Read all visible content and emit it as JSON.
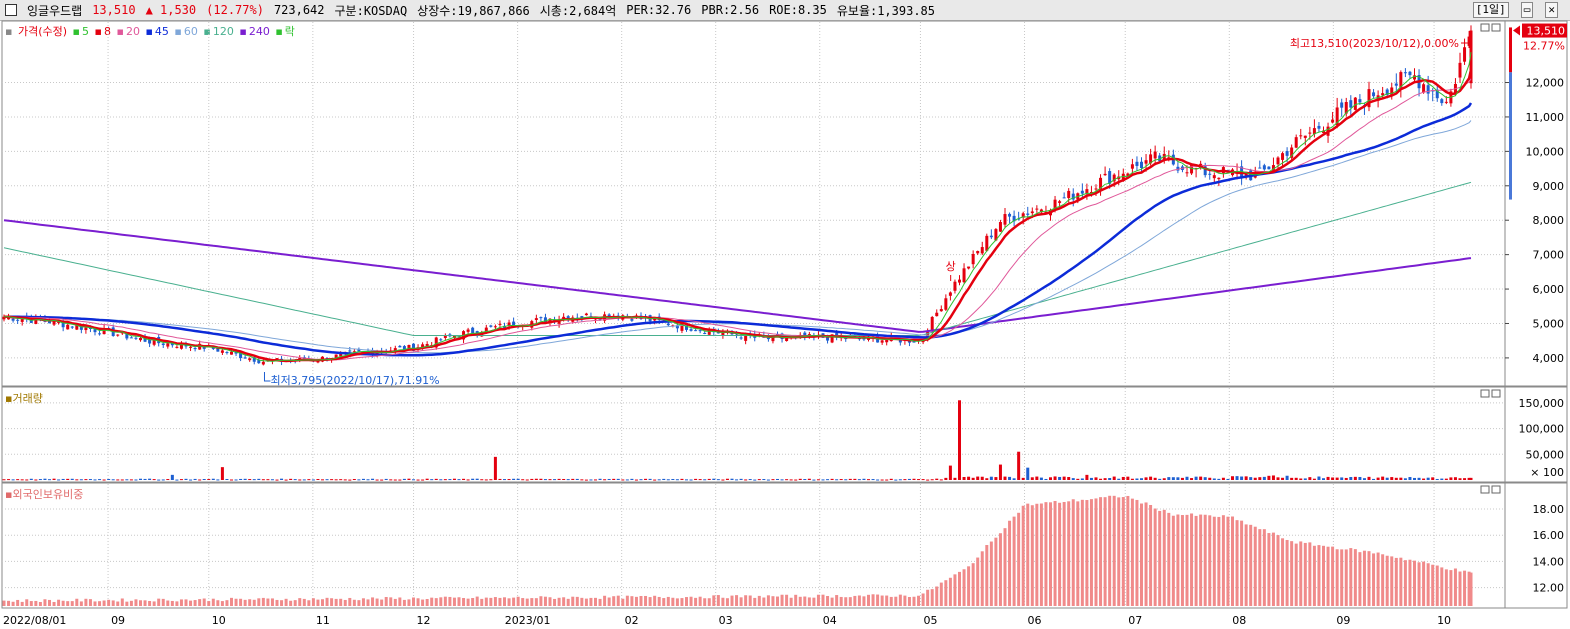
{
  "header": {
    "name": "잉글우드랩",
    "price": "13,510",
    "change": "▲ 1,530",
    "change_pct": "(12.77%)",
    "volume": "723,642",
    "market": "구분:KOSDAQ",
    "shares": "상장수:19,867,866",
    "mcap": "시총:2,684억",
    "per": "PER:32.76",
    "pbr": "PBR:2.56",
    "roe": "ROE:8.35",
    "float": "유보율:1,393.85",
    "period_btn": "[1일]",
    "restore_icon": "restore-icon",
    "close_icon": "close-icon"
  },
  "legend": {
    "price": "가격(수정)",
    "ma5": "5",
    "ma8": "8",
    "ma20": "20",
    "ma45": "45",
    "ma60": "60",
    "ma120": "120",
    "ma240": "240",
    "fall": "락"
  },
  "annotations": {
    "high": "최고13,510(2023/10/12),0.00%",
    "low": "최저3,795(2022/10/17),71.91%",
    "upper_limit": "상",
    "last_price": "13,510",
    "last_pct": "12.77%"
  },
  "volume_panel": {
    "title": "거래량",
    "unit": "× 100"
  },
  "foreign_panel": {
    "title": "외국인보유비중"
  },
  "colors": {
    "up": "#e4000f",
    "down": "#1d5fd1",
    "ma5": "#2fc12f",
    "ma8": "#e4000f",
    "ma20": "#e0589a",
    "ma45": "#0c2bd8",
    "ma60": "#7fa7d9",
    "ma120": "#49b08f",
    "ma240": "#7a1ed0",
    "foreign": "#f08a8a"
  },
  "chart_data": [
    {
      "type": "candlestick",
      "title": "",
      "x_ticks": [
        "2022/08/01",
        "09",
        "10",
        "11",
        "12",
        "2023/01",
        "02",
        "03",
        "04",
        "05",
        "06",
        "07",
        "08",
        "09",
        "10"
      ],
      "y_ticks": [
        4000,
        5000,
        6000,
        7000,
        8000,
        9000,
        10000,
        11000,
        12000
      ],
      "ylim": [
        3300,
        13700
      ],
      "series_names": [
        "5",
        "8",
        "20",
        "45",
        "60",
        "120",
        "240"
      ],
      "key_points": {
        "high": {
          "date": "2023/10/12",
          "value": 13510
        },
        "low": {
          "date": "2022/10/17",
          "value": 3795
        }
      },
      "close_path": [
        [
          "2022/08/01",
          5200
        ],
        [
          "2022/08/15",
          5050
        ],
        [
          "2022/09/01",
          4750
        ],
        [
          "2022/09/15",
          4450
        ],
        [
          "2022/10/01",
          4300
        ],
        [
          "2022/10/17",
          3900
        ],
        [
          "2022/11/01",
          3950
        ],
        [
          "2022/11/15",
          4150
        ],
        [
          "2022/12/01",
          4300
        ],
        [
          "2022/12/15",
          4700
        ],
        [
          "2023/01/01",
          5000
        ],
        [
          "2023/01/15",
          5200
        ],
        [
          "2023/02/01",
          5250
        ],
        [
          "2023/02/15",
          5000
        ],
        [
          "2023/03/01",
          4750
        ],
        [
          "2023/03/15",
          4550
        ],
        [
          "2023/04/01",
          4600
        ],
        [
          "2023/04/15",
          4550
        ],
        [
          "2023/05/01",
          4500
        ],
        [
          "2023/05/10",
          6000
        ],
        [
          "2023/05/25",
          8000
        ],
        [
          "2023/06/10",
          8500
        ],
        [
          "2023/06/25",
          9200
        ],
        [
          "2023/07/10",
          9800
        ],
        [
          "2023/07/25",
          9400
        ],
        [
          "2023/08/10",
          9300
        ],
        [
          "2023/08/20",
          10200
        ],
        [
          "2023/09/01",
          11000
        ],
        [
          "2023/09/15",
          11800
        ],
        [
          "2023/09/25",
          12200
        ],
        [
          "2023/10/05",
          11400
        ],
        [
          "2023/10/12",
          13510
        ]
      ]
    },
    {
      "type": "bar",
      "title": "거래량",
      "y_ticks": [
        50000,
        100000,
        150000
      ],
      "ylim": [
        0,
        175000
      ],
      "spikes": [
        [
          "2022/09/20",
          10000
        ],
        [
          "2022/10/05",
          25000
        ],
        [
          "2022/12/25",
          45000
        ],
        [
          "2023/05/10",
          28000
        ],
        [
          "2023/05/12",
          155000
        ],
        [
          "2023/05/25",
          30000
        ],
        [
          "2023/05/30",
          55000
        ],
        [
          "2023/06/02",
          24000
        ],
        [
          "2023/06/20",
          10000
        ]
      ]
    },
    {
      "type": "bar",
      "title": "외국인보유비중",
      "y_ticks": [
        12.0,
        14.0,
        16.0,
        18.0
      ],
      "ylim": [
        10.6,
        19.6
      ],
      "path": [
        [
          "2022/08/01",
          11.0
        ],
        [
          "2023/05/01",
          11.4
        ],
        [
          "2023/05/15",
          13.5
        ],
        [
          "2023/06/01",
          18.3
        ],
        [
          "2023/07/01",
          19.0
        ],
        [
          "2023/07/15",
          17.6
        ],
        [
          "2023/08/01",
          17.4
        ],
        [
          "2023/08/20",
          15.5
        ],
        [
          "2023/09/15",
          14.6
        ],
        [
          "2023/10/12",
          13.1
        ]
      ]
    }
  ]
}
